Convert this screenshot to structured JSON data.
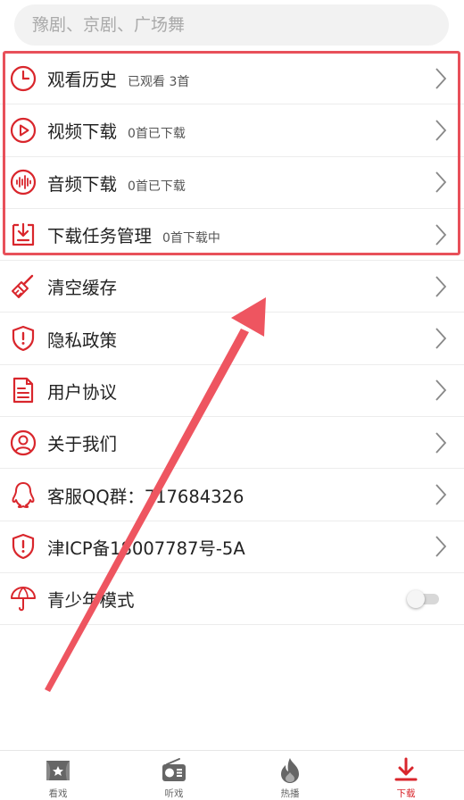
{
  "search": {
    "placeholder": "豫剧、京剧、广场舞"
  },
  "colors": {
    "accent": "#d9262c",
    "highlight_box": "#e8505a",
    "annotation_arrow": "#ee5560"
  },
  "menu": [
    {
      "icon": "clock-icon",
      "label": "观看历史",
      "sub": "已观看 3首",
      "chevron": true
    },
    {
      "icon": "play-circle-icon",
      "label": "视频下载",
      "sub": "0首已下载",
      "chevron": true
    },
    {
      "icon": "audio-wave-icon",
      "label": "音频下载",
      "sub": "0首已下载",
      "chevron": true
    },
    {
      "icon": "download-task-icon",
      "label": "下载任务管理",
      "sub": "0首下载中",
      "chevron": true
    },
    {
      "icon": "broom-icon",
      "label": "清空缓存",
      "chevron": true
    },
    {
      "icon": "shield-icon",
      "label": "隐私政策",
      "chevron": true
    },
    {
      "icon": "document-icon",
      "label": "用户协议",
      "chevron": true
    },
    {
      "icon": "user-circle-icon",
      "label": "关于我们",
      "chevron": true
    },
    {
      "icon": "qq-icon",
      "label": "客服QQ群：717684326",
      "chevron": true
    },
    {
      "icon": "shield-icon",
      "label": "津ICP备18007787号-5A",
      "chevron": true
    },
    {
      "icon": "umbrella-icon",
      "label": "青少年模式",
      "toggle": false
    }
  ],
  "tabs": [
    {
      "icon": "theater-icon",
      "label": "看戏",
      "active": false
    },
    {
      "icon": "radio-icon",
      "label": "听戏",
      "active": false
    },
    {
      "icon": "flame-icon",
      "label": "热播",
      "active": false
    },
    {
      "icon": "download-icon",
      "label": "下载",
      "active": true
    }
  ]
}
